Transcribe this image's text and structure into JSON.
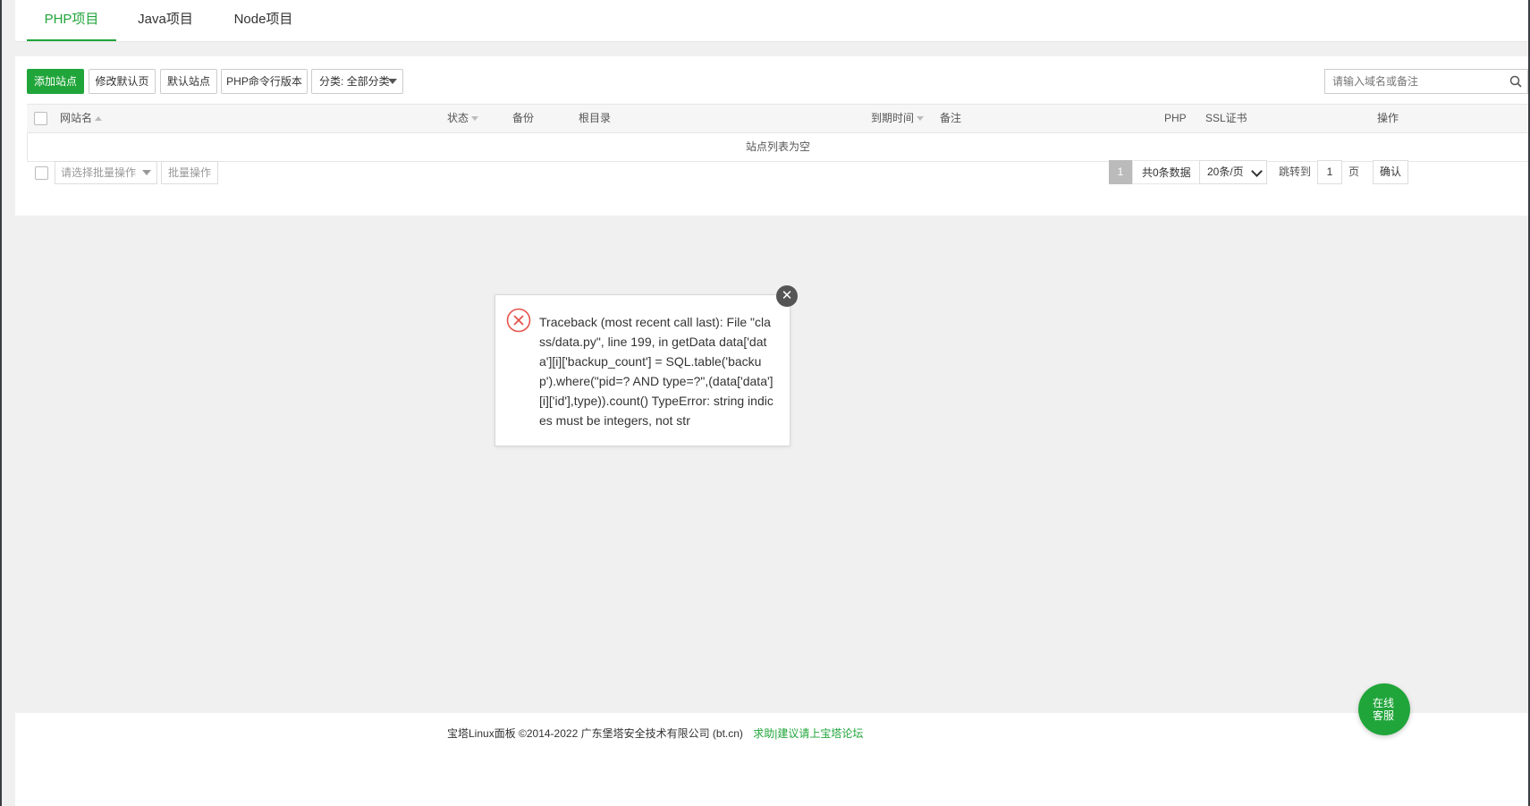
{
  "tabs": [
    {
      "label": "PHP项目",
      "active": true
    },
    {
      "label": "Java项目",
      "active": false
    },
    {
      "label": "Node项目",
      "active": false
    }
  ],
  "toolbar": {
    "add_site": "添加站点",
    "edit_default_page": "修改默认页",
    "default_site": "默认站点",
    "php_cli_version": "PHP命令行版本",
    "category": "分类: 全部分类"
  },
  "search": {
    "placeholder": "请输入域名或备注"
  },
  "table": {
    "columns": {
      "site_name": "网站名",
      "status": "状态",
      "backup": "备份",
      "root": "根目录",
      "expire": "到期时间",
      "remark": "备注",
      "php": "PHP",
      "ssl": "SSL证书",
      "actions": "操作"
    },
    "empty_text": "站点列表为空"
  },
  "batch": {
    "select_placeholder": "请选择批量操作",
    "button": "批量操作"
  },
  "pagination": {
    "current_page": "1",
    "total": "共0条数据",
    "page_size": "20条/页",
    "jump_label": "跳转到",
    "jump_value": "1",
    "page_unit": "页",
    "confirm": "确认"
  },
  "error_dialog": {
    "message": "Traceback (most recent call last): File \"class/data.py\", line 199, in getData data['data'][i]['backup_count'] = SQL.table('backup').where(\"pid=? AND type=?\",(data['data'][i]['id'],type)).count() TypeError: string indices must be integers, not str",
    "close_symbol": "✕"
  },
  "footer": {
    "copyright": "宝塔Linux面板 ©2014-2022 广东堡塔安全技术有限公司 (bt.cn)",
    "link": "求助|建议请上宝塔论坛"
  },
  "chat": {
    "label": "在线客服"
  },
  "colors": {
    "accent": "#20a53a",
    "error": "#e5534b"
  }
}
